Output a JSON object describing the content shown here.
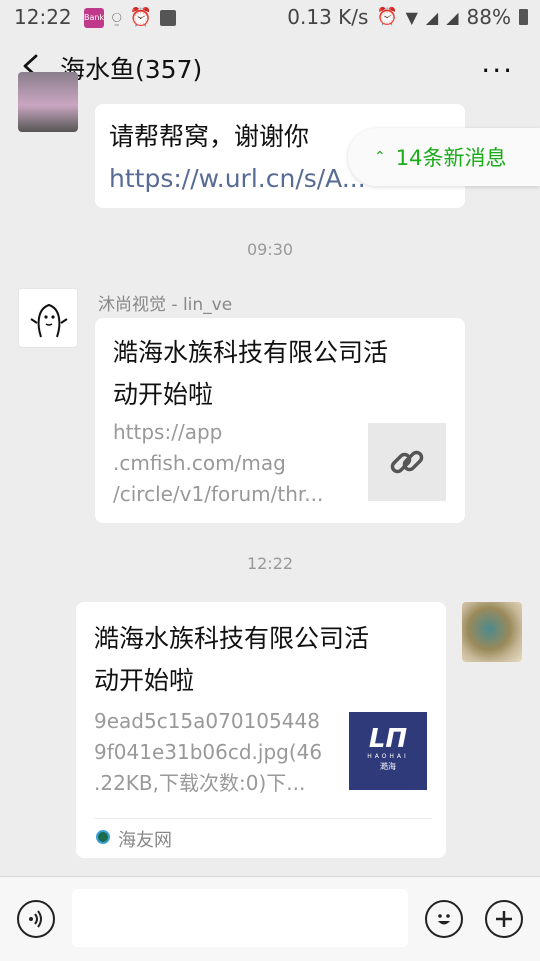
{
  "status_bar": {
    "time": "12:22",
    "app_badge": "Bank",
    "net_speed": "0.13 K/s",
    "battery": "88%"
  },
  "header": {
    "title": "海水鱼(357)",
    "more": "···"
  },
  "new_messages": {
    "label": "14条新消息"
  },
  "messages": [
    {
      "type": "text",
      "text": "请帮帮窝，谢谢你",
      "link": "https://w.url.cn/s/A..."
    },
    {
      "type": "time",
      "text": "09:30"
    },
    {
      "type": "link_card",
      "sender": "沐尚视觉 - lin_ve",
      "title_line1": "澔海水族科技有限公司活",
      "title_line2": "动开始啦",
      "url_line1": "https://app",
      "url_line2": ".cmfish.com/mag",
      "url_line3": "/circle/v1/forum/thr..."
    },
    {
      "type": "time",
      "text": "12:22"
    },
    {
      "type": "file_card",
      "title_line1": "澔海水族科技有限公司活",
      "title_line2": "动开始啦",
      "desc_line1": "9ead5c15a070105448",
      "desc_line2": "9f041e31b06cd.jpg(46",
      "desc_line3": ".22KB,下载次数:0)下...",
      "logo_text": "HAOHAI",
      "logo_sub": "澔海",
      "source": "海友网"
    }
  ],
  "colors": {
    "bg": "#ededed",
    "link": "#576b95",
    "green": "#1aad19",
    "logo_bg": "#2f3a7a"
  }
}
